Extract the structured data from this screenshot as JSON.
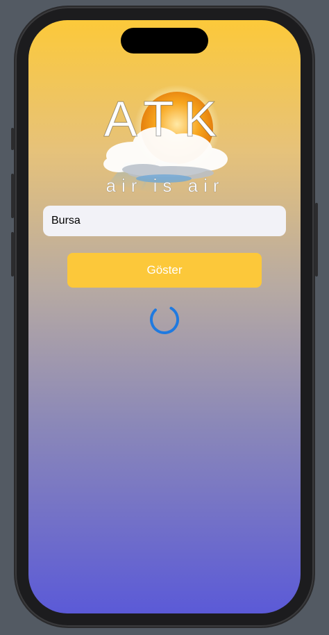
{
  "app": {
    "logo": {
      "title": "ATK",
      "tagline": "air is air",
      "image_icon": "sun-behind-cloud-icon"
    },
    "city_input": {
      "value": "Bursa"
    },
    "show_button": {
      "label": "Göster"
    },
    "loading_indicator": {
      "icon": "spinner-icon",
      "color": "#1f7ae0"
    }
  },
  "colors": {
    "gradient_top": "#fcc93a",
    "gradient_bottom": "#5b5ad7",
    "button_accent": "#fcc83a",
    "field_background": "#f2f2f7"
  }
}
